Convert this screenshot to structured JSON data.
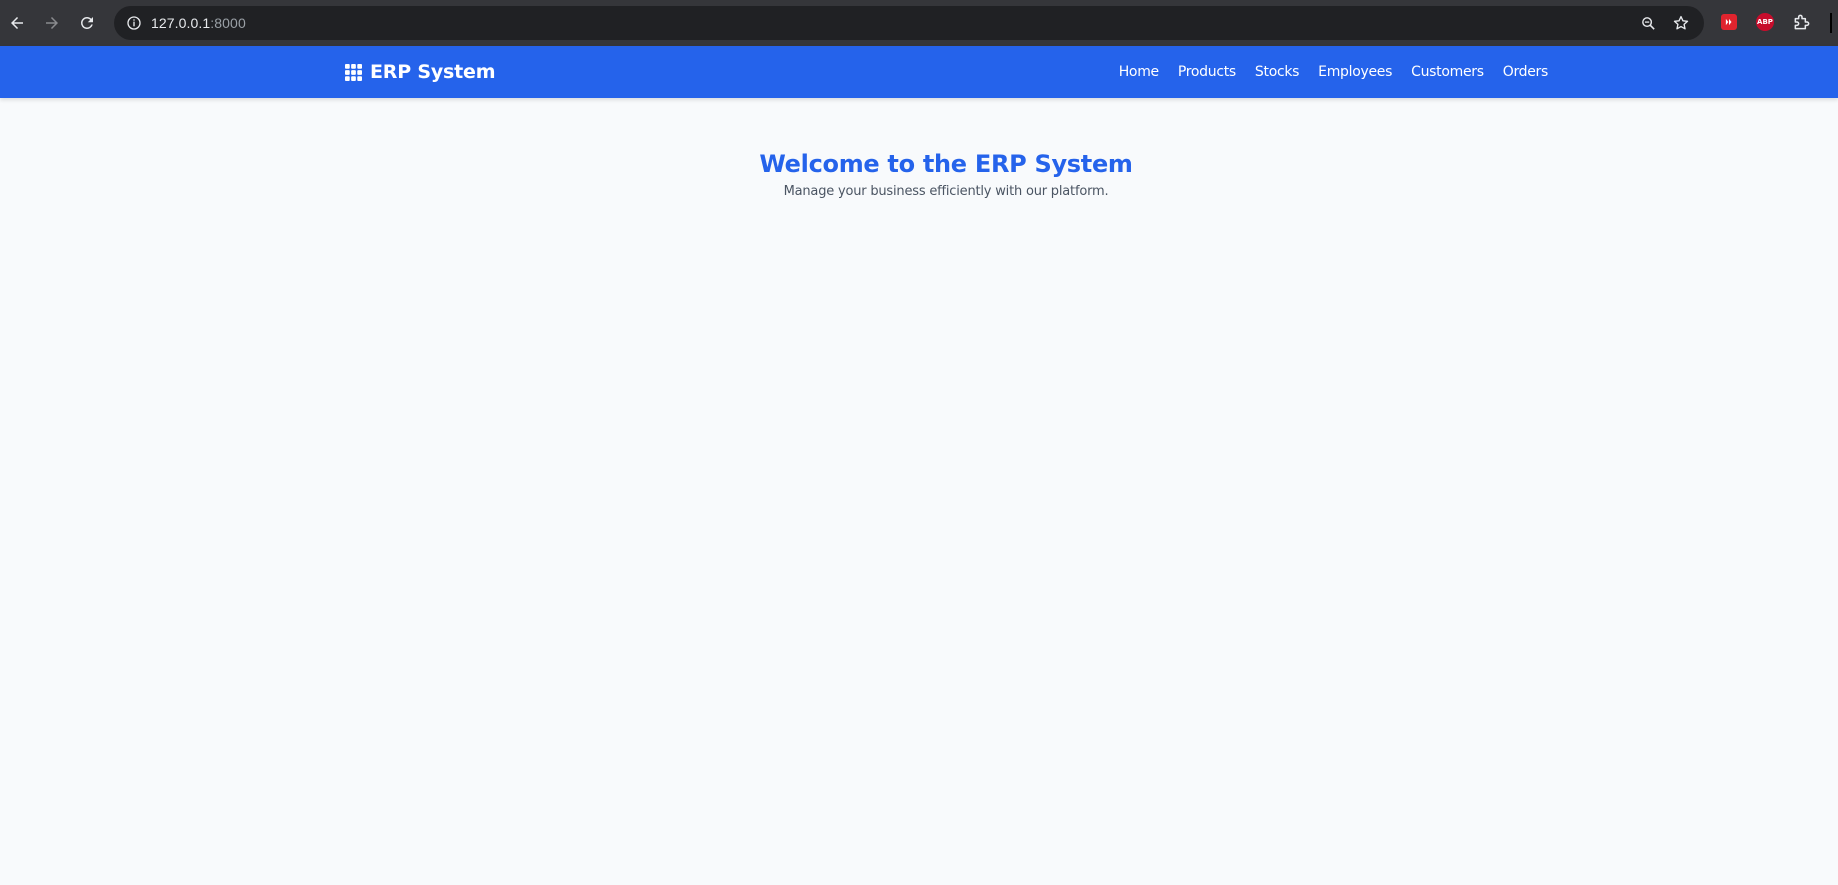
{
  "browser": {
    "url_host": "127.0.0.1",
    "url_port": ":8000",
    "extensions": [
      {
        "icon": "red-square-extension-icon"
      },
      {
        "icon": "abp-icon",
        "label": "ABP"
      },
      {
        "icon": "puzzle-icon"
      }
    ]
  },
  "navbar": {
    "brand_name": "ERP System",
    "brand_icon": "grid-icon",
    "links": [
      {
        "label": "Home"
      },
      {
        "label": "Products"
      },
      {
        "label": "Stocks"
      },
      {
        "label": "Employees"
      },
      {
        "label": "Customers"
      },
      {
        "label": "Orders"
      }
    ]
  },
  "main": {
    "title": "Welcome to the ERP System",
    "subtitle": "Manage your business efficiently with our platform."
  },
  "colors": {
    "primary": "#2563eb",
    "background": "#f8fafc",
    "subtitle_text": "#4b5563"
  }
}
